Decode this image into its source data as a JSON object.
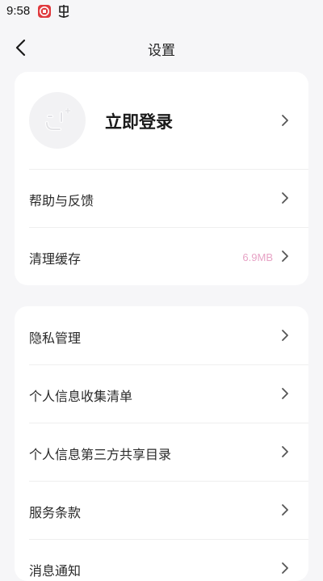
{
  "status_bar": {
    "time": "9:58"
  },
  "header": {
    "title": "设置"
  },
  "account": {
    "login_label": "立即登录"
  },
  "group1": {
    "items": [
      {
        "label": "帮助与反馈",
        "value": ""
      },
      {
        "label": "清理缓存",
        "value": "6.9MB"
      }
    ]
  },
  "group2": {
    "items": [
      {
        "label": "隐私管理"
      },
      {
        "label": "个人信息收集清单"
      },
      {
        "label": "个人信息第三方共享目录"
      },
      {
        "label": "服务条款"
      },
      {
        "label": "消息通知"
      }
    ]
  },
  "colors": {
    "background": "#f6f6f8",
    "card": "#ffffff",
    "accent_value": "#e7a3c5",
    "app_icon_red": "#e03a3e"
  },
  "icons": {
    "back": "back-arrow-icon",
    "avatar": "smiley-avatar-icon",
    "chevron": "chevron-right-icon"
  }
}
